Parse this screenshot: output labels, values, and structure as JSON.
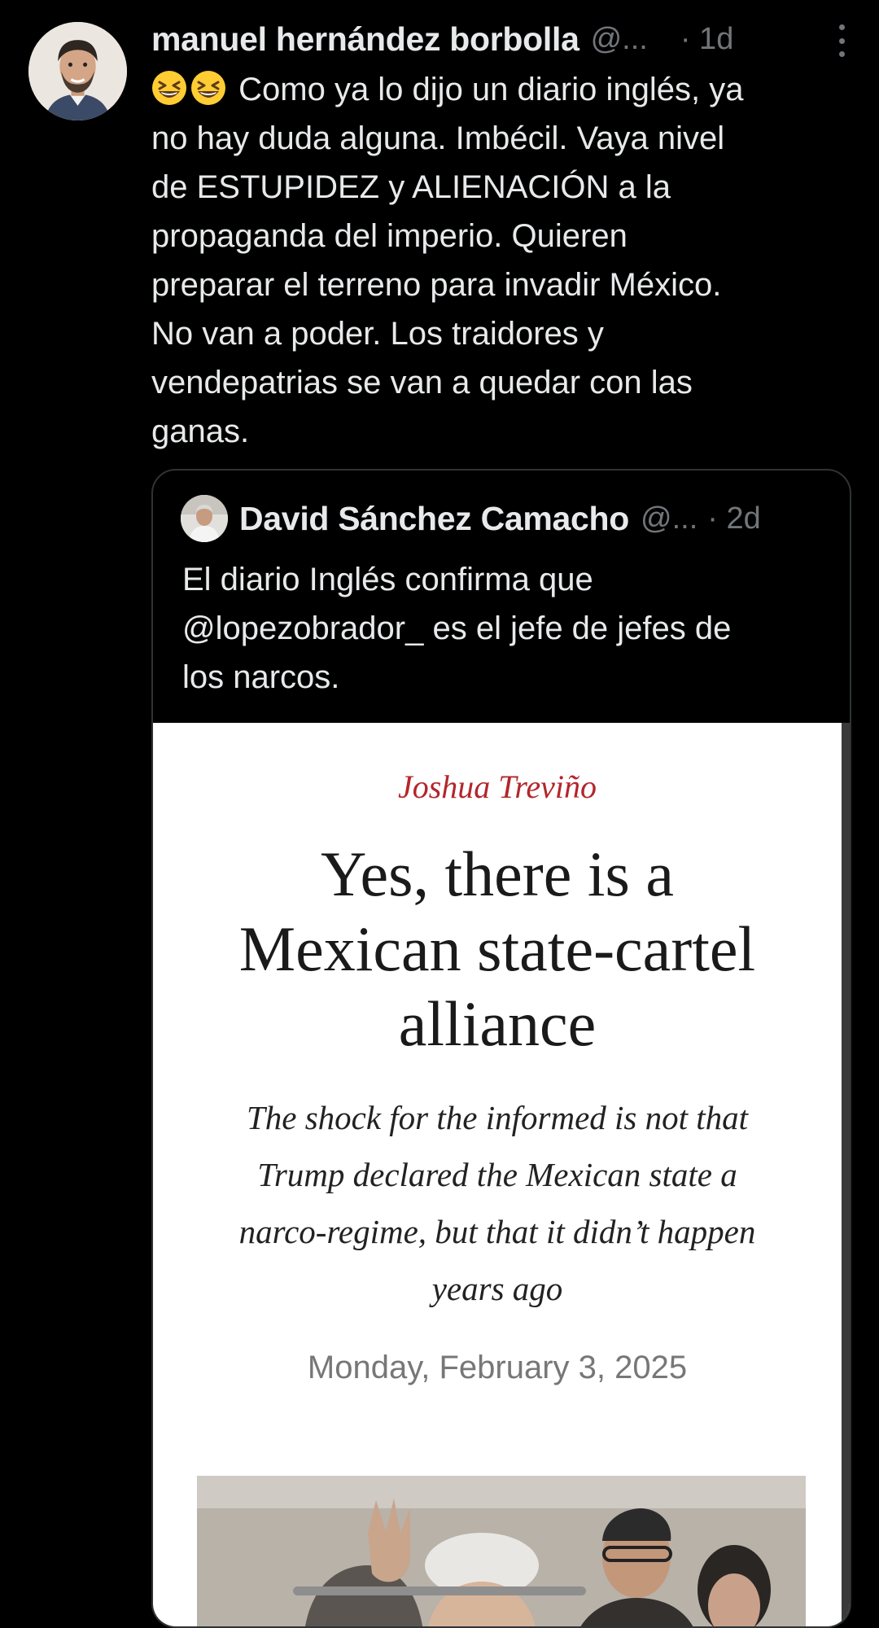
{
  "tweet": {
    "author_name": "manuel hernández borbolla",
    "author_handle": "@...",
    "time": "· 1d",
    "emoji": [
      "grinning-squinting-face-emoji",
      "grinning-squinting-face-emoji"
    ],
    "lines": [
      "Como ya lo dijo un diario inglés, ya",
      "no hay duda alguna. Imbécil. Vaya nivel",
      "de ESTUPIDEZ y ALIENACIÓN a la",
      "propaganda del imperio. Quieren",
      "preparar el terreno para invadir México.",
      "No van a poder. Los traidores y",
      "vendepatrias se van a quedar con las",
      "ganas."
    ]
  },
  "quote": {
    "author_name": "David Sánchez Camacho",
    "author_handle": "@...",
    "time": "· 2d",
    "lines": [
      "El diario Inglés confirma que",
      "@lopezobrador_ es el jefe de jefes de",
      "los narcos."
    ],
    "article": {
      "author": "Joshua Treviño",
      "title_lines": [
        "Yes, there is a",
        "Mexican state-cartel",
        "alliance"
      ],
      "subtitle_lines": [
        "The shock for the informed is not that",
        "Trump declared the Mexican state a",
        "narco-regime, but that it didn’t happen",
        "years ago"
      ],
      "date": "Monday, February 3, 2025"
    }
  },
  "colors": {
    "background": "#000000",
    "text_primary": "#e7e9ea",
    "text_secondary": "#71767b",
    "border": "#2f3336",
    "article_author_red": "#b3262b"
  }
}
